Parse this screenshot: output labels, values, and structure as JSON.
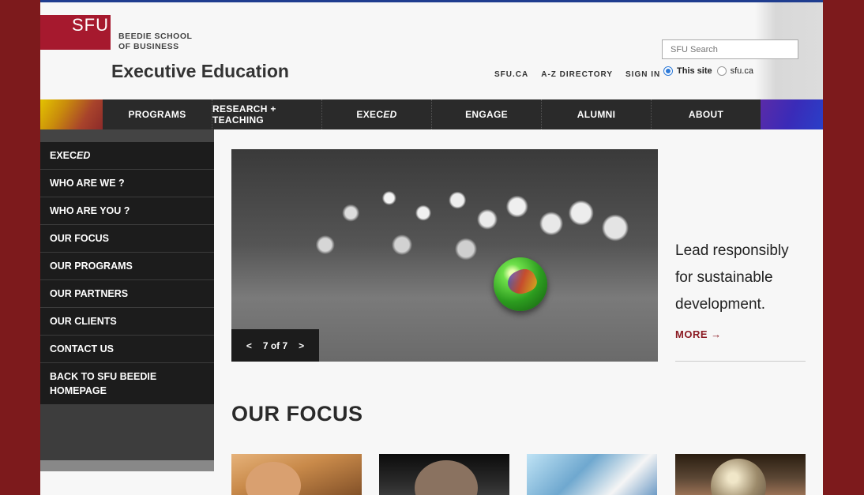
{
  "header": {
    "logo_text": "SFU",
    "school_line1": "BEEDIE SCHOOL",
    "school_line2": "OF BUSINESS",
    "site_title": "Executive Education",
    "util_links": [
      "SFU.CA",
      "A-Z DIRECTORY",
      "SIGN IN"
    ],
    "search_placeholder": "SFU Search",
    "radio_this_site": "This site",
    "radio_sfu": "sfu.ca"
  },
  "nav": {
    "items": [
      {
        "label": "PROGRAMS"
      },
      {
        "label": "RESEARCH + TEACHING"
      },
      {
        "label_prefix": "EXEC",
        "label_italic": "ED"
      },
      {
        "label": "ENGAGE"
      },
      {
        "label": "ALUMNI"
      },
      {
        "label": "ABOUT"
      }
    ]
  },
  "sidebar": {
    "first_prefix": "EXEC",
    "first_italic": "ED",
    "items": [
      "WHO ARE WE ?",
      "WHO ARE YOU ?",
      "OUR FOCUS",
      "OUR PROGRAMS",
      "OUR PARTNERS",
      "OUR CLIENTS",
      "CONTACT US"
    ],
    "back_line1": "BACK TO SFU BEEDIE",
    "back_line2": "HOMEPAGE"
  },
  "slider": {
    "prev": "<",
    "counter": "7 of 7",
    "next": ">",
    "caption": "Lead responsibly for sustainable development.",
    "more_label": "MORE",
    "more_arrow": "→"
  },
  "focus": {
    "heading": "OUR FOCUS"
  },
  "colors": {
    "brand_red": "#a6192e",
    "link_red": "#8b1a22",
    "nav_bg": "#2a2a2a",
    "page_bg": "#7d1a1c"
  }
}
